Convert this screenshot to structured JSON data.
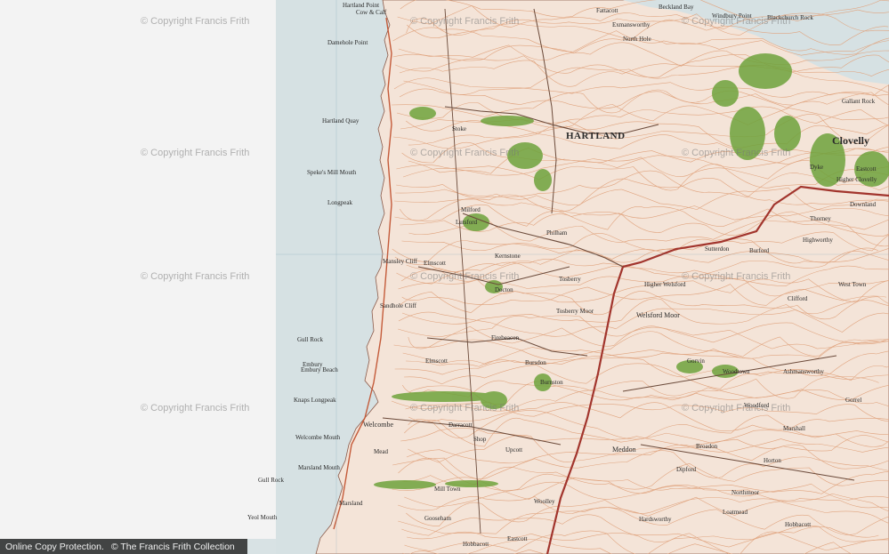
{
  "map": {
    "colors": {
      "sea": "#d6e1e3",
      "land": "#f4e4d8",
      "contour": "#e0a47f",
      "road_main": "#a2352d",
      "road": "#6b4a3a",
      "woodland": "#6fa33c",
      "cliff": "#c45b3a",
      "blank": "#f3f3f3"
    },
    "places_large": [
      {
        "name": "HARTLAND"
      },
      {
        "name": "Clovelly"
      },
      {
        "name": "Welcombe"
      },
      {
        "name": "Meddon"
      },
      {
        "name": "Burnston"
      },
      {
        "name": "Welsford Moor"
      }
    ],
    "places": [
      {
        "name": "Stoke"
      },
      {
        "name": "Hartland Quay"
      },
      {
        "name": "Speke's Mill Mouth"
      },
      {
        "name": "Longpeak"
      },
      {
        "name": "Elmscott"
      },
      {
        "name": "Mansley Cliff"
      },
      {
        "name": "Gull Rock"
      },
      {
        "name": "Embury Beach"
      },
      {
        "name": "Knaps Longpeak"
      },
      {
        "name": "Welcombe Mouth"
      },
      {
        "name": "Marsland Mouth"
      },
      {
        "name": "Yeol Mouth"
      },
      {
        "name": "Marsland"
      },
      {
        "name": "Mead"
      },
      {
        "name": "Gooseham"
      },
      {
        "name": "Hobbacott"
      },
      {
        "name": "Eastcott"
      },
      {
        "name": "Woolley"
      },
      {
        "name": "Shop"
      },
      {
        "name": "Upcott"
      },
      {
        "name": "Darracott"
      },
      {
        "name": "Elmscott"
      },
      {
        "name": "Tosberry"
      },
      {
        "name": "Tosberry Moor"
      },
      {
        "name": "Philham"
      },
      {
        "name": "Lutsford"
      },
      {
        "name": "Kernstone"
      },
      {
        "name": "Firebeacon"
      },
      {
        "name": "Milford"
      },
      {
        "name": "Docton"
      },
      {
        "name": "Exmansworthy"
      },
      {
        "name": "Fattacott"
      },
      {
        "name": "North Hole"
      },
      {
        "name": "Higher Welsford"
      },
      {
        "name": "Sutterdon"
      },
      {
        "name": "Burford"
      },
      {
        "name": "Higher Clovelly"
      },
      {
        "name": "Downland"
      },
      {
        "name": "Thorney"
      },
      {
        "name": "Highworthy"
      },
      {
        "name": "West Town"
      },
      {
        "name": "Clifford"
      },
      {
        "name": "Woodtown"
      },
      {
        "name": "Gorvin"
      },
      {
        "name": "Gorrel"
      },
      {
        "name": "Ashmansworthy"
      },
      {
        "name": "Northmoor"
      },
      {
        "name": "Loatmead"
      },
      {
        "name": "Hardsworthy"
      },
      {
        "name": "Horton"
      },
      {
        "name": "Broadon"
      },
      {
        "name": "Dipford"
      },
      {
        "name": "Marshall"
      },
      {
        "name": "Mill Town"
      },
      {
        "name": "Eastcott"
      },
      {
        "name": "Woodford"
      },
      {
        "name": "Bursdon"
      },
      {
        "name": "Dyke"
      },
      {
        "name": "Hobbacott"
      },
      {
        "name": "Blackchurch Rock"
      },
      {
        "name": "Gallant Rock"
      },
      {
        "name": "Embury"
      },
      {
        "name": "Gull Rock"
      },
      {
        "name": "Sandhole Cliff"
      },
      {
        "name": "Hartland Point"
      },
      {
        "name": "Damehole Point"
      },
      {
        "name": "Cow & Calf"
      },
      {
        "name": "Windbury Point"
      },
      {
        "name": "Beckland Bay"
      }
    ]
  },
  "watermarks": [
    "© Copyright Francis Frith",
    "© Copyright Francis Frith",
    "© Copyright Francis Frith",
    "© Copyright Francis Frith",
    "© Copyright Francis Frith",
    "© Copyright Francis Frith",
    "© Copyright Francis Frith",
    "© Copyright Francis Frith",
    "© Copyright Francis Frith",
    "© Copyright Francis Frith",
    "© Copyright Francis Frith",
    "© Copyright Francis Frith"
  ],
  "footer": {
    "left": "Online Copy Protection.",
    "right": "© The Francis Frith Collection"
  }
}
